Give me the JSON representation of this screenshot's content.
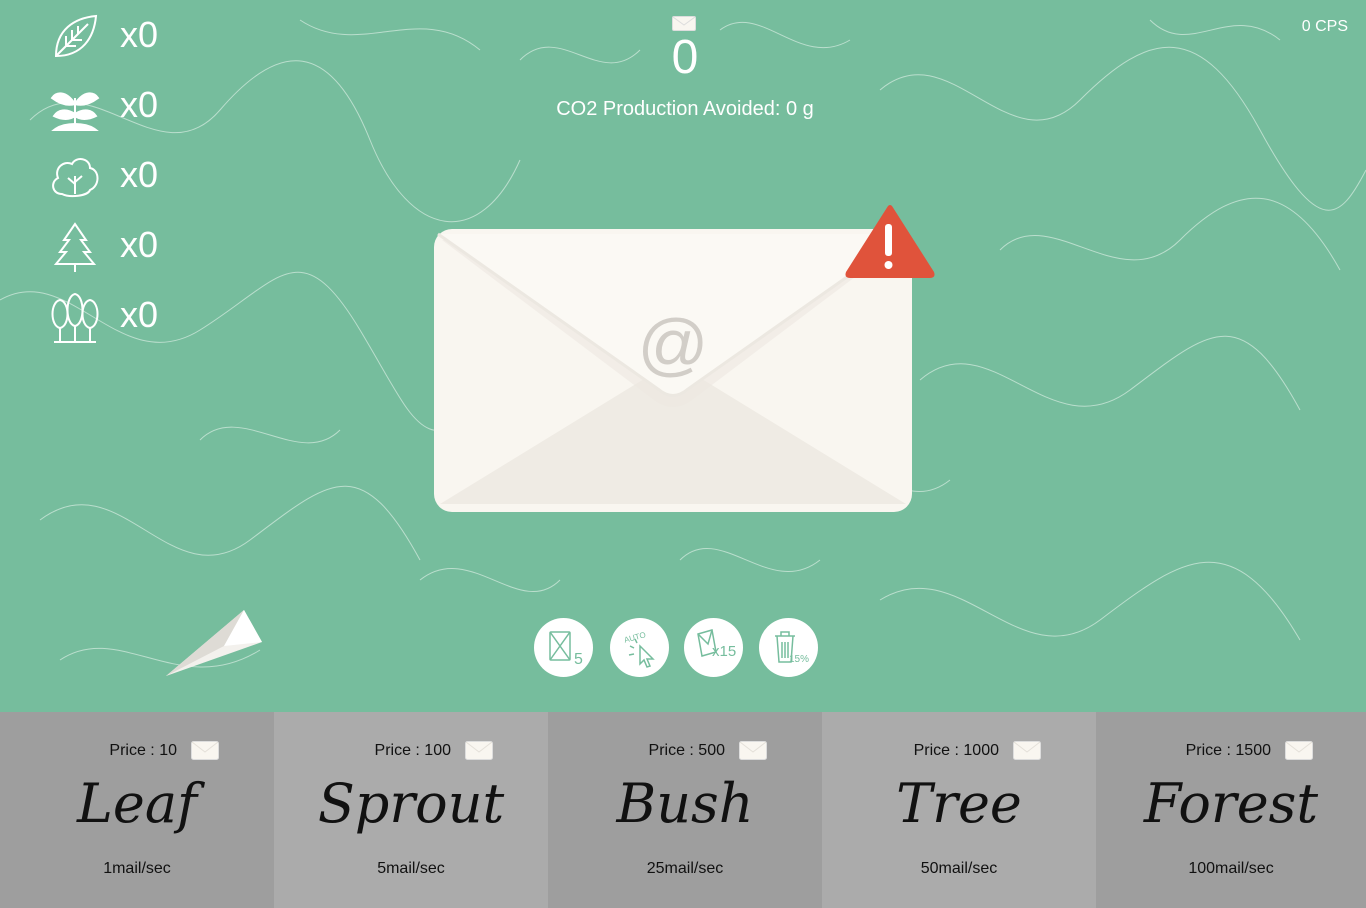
{
  "counters": [
    {
      "icon": "leaf-icon",
      "count": "x0"
    },
    {
      "icon": "sprout-icon",
      "count": "x0"
    },
    {
      "icon": "bush-icon",
      "count": "x0"
    },
    {
      "icon": "tree-icon",
      "count": "x0"
    },
    {
      "icon": "forest-icon",
      "count": "x0"
    }
  ],
  "header": {
    "mail_count": "0",
    "co2_text": "CO2 Production Avoided: 0 g",
    "cps": "0 CPS"
  },
  "main_envelope": {
    "icon": "email-envelope-icon",
    "alert_icon": "warning-icon"
  },
  "powerups": [
    {
      "icon": "mail-x5-icon"
    },
    {
      "icon": "auto-click-icon"
    },
    {
      "icon": "mail-x15-icon"
    },
    {
      "icon": "trash-15-percent-icon"
    }
  ],
  "shop": [
    {
      "price": "Price : 10",
      "name": "Leaf",
      "rate": "1mail/sec"
    },
    {
      "price": "Price : 100",
      "name": "Sprout",
      "rate": "5mail/sec"
    },
    {
      "price": "Price : 500",
      "name": "Bush",
      "rate": "25mail/sec"
    },
    {
      "price": "Price : 1000",
      "name": "Tree",
      "rate": "50mail/sec"
    },
    {
      "price": "Price : 1500",
      "name": "Forest",
      "rate": "100mail/sec"
    }
  ],
  "colors": {
    "background": "#76bd9d",
    "shop_dark": "#9e9e9e",
    "shop_light": "#ababab",
    "alert": "#e0533b",
    "envelope": "#f9f6f0"
  }
}
